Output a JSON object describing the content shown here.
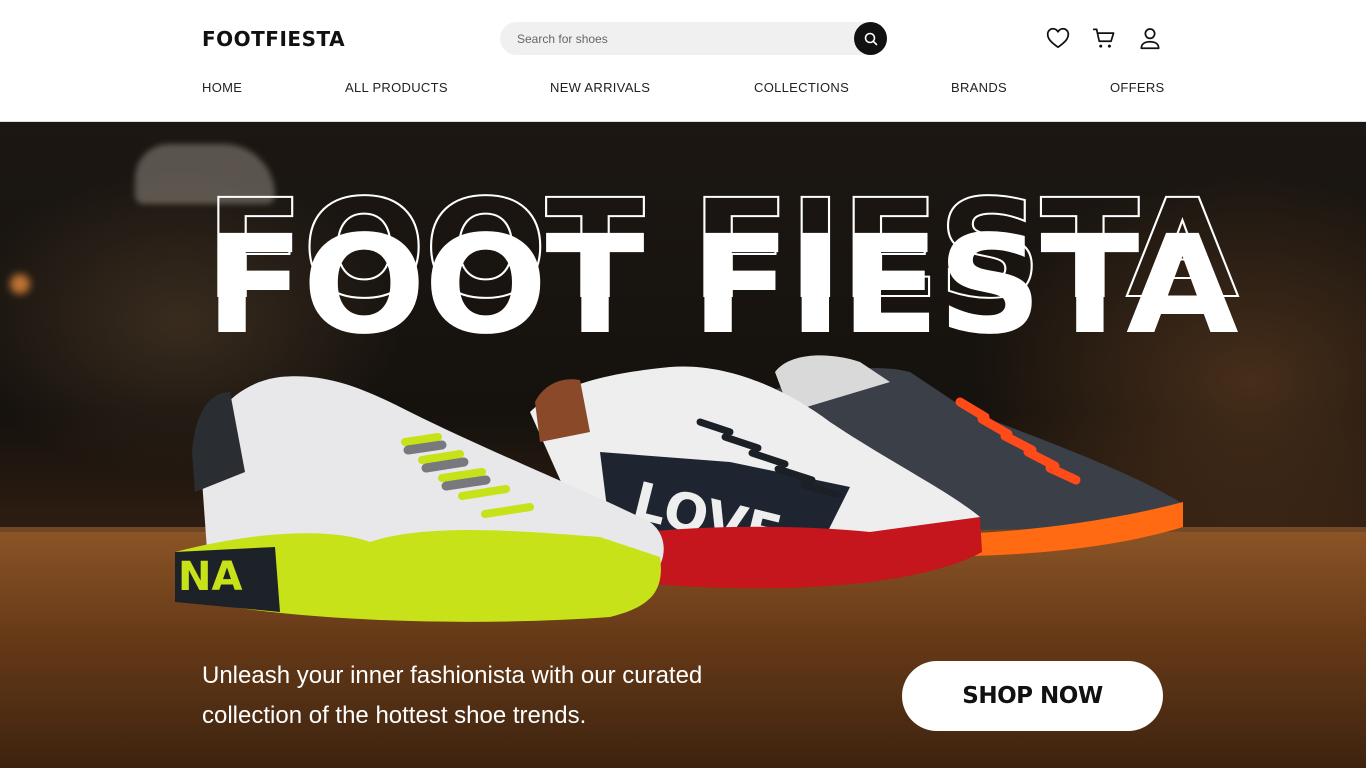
{
  "header": {
    "logo": "FOOTFIESTA",
    "search": {
      "placeholder": "Search for shoes"
    },
    "icons": [
      "heart-icon",
      "cart-icon",
      "user-icon"
    ]
  },
  "nav": {
    "items": [
      {
        "label": "HOME"
      },
      {
        "label": "ALL PRODUCTS"
      },
      {
        "label": "NEW ARRIVALS"
      },
      {
        "label": "COLLECTIONS"
      },
      {
        "label": "BRANDS"
      },
      {
        "label": "OFFERS"
      }
    ]
  },
  "hero": {
    "title": "FOOT FIESTA",
    "tagline_line1": "Unleash your inner fashionista with our curated",
    "tagline_line2": "collection of the hottest shoe trends.",
    "shoe_text": {
      "left": "NA",
      "middle": "LOVE"
    },
    "cta_label": "SHOP NOW"
  },
  "colors": {
    "accent_dark": "#111111",
    "sole_yellow": "#c8e21a",
    "sole_red": "#c4161c",
    "sole_orange": "#ff6a13"
  }
}
